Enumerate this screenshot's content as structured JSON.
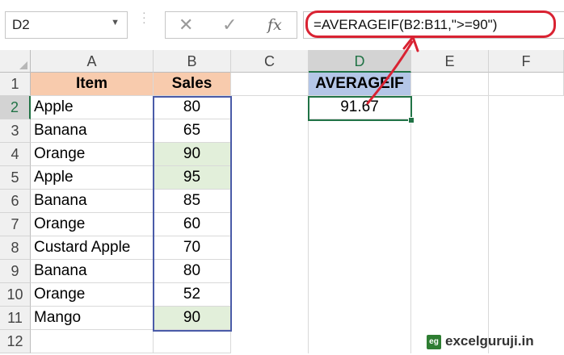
{
  "formula_bar": {
    "name_box": "D2",
    "cancel_glyph": "✕",
    "enter_glyph": "✓",
    "fx_label": "fx",
    "formula": "=AVERAGEIF(B2:B11,\">=90\")"
  },
  "columns": [
    "A",
    "B",
    "C",
    "D",
    "E",
    "F"
  ],
  "rows": [
    "1",
    "2",
    "3",
    "4",
    "5",
    "6",
    "7",
    "8",
    "9",
    "10",
    "11",
    "12"
  ],
  "headers": {
    "item": "Item",
    "sales": "Sales",
    "averageif": "AVERAGEIF"
  },
  "data_rows": [
    {
      "item": "Apple",
      "sales": "80",
      "highlighted": false
    },
    {
      "item": "Banana",
      "sales": "65",
      "highlighted": false
    },
    {
      "item": "Orange",
      "sales": "90",
      "highlighted": true
    },
    {
      "item": "Apple",
      "sales": "95",
      "highlighted": true
    },
    {
      "item": "Banana",
      "sales": "85",
      "highlighted": false
    },
    {
      "item": "Orange",
      "sales": "60",
      "highlighted": false
    },
    {
      "item": "Custard Apple",
      "sales": "70",
      "highlighted": false
    },
    {
      "item": "Banana",
      "sales": "80",
      "highlighted": false
    },
    {
      "item": "Orange",
      "sales": "52",
      "highlighted": false
    },
    {
      "item": "Mango",
      "sales": "90",
      "highlighted": true
    }
  ],
  "result": "91.67",
  "watermark": "excelguruji.in",
  "colors": {
    "header_orange": "#f8cbad",
    "header_blue": "#b4c6e7",
    "highlight_green": "#e2efda",
    "annotation_red": "#d92232",
    "selection_green": "#217346"
  }
}
